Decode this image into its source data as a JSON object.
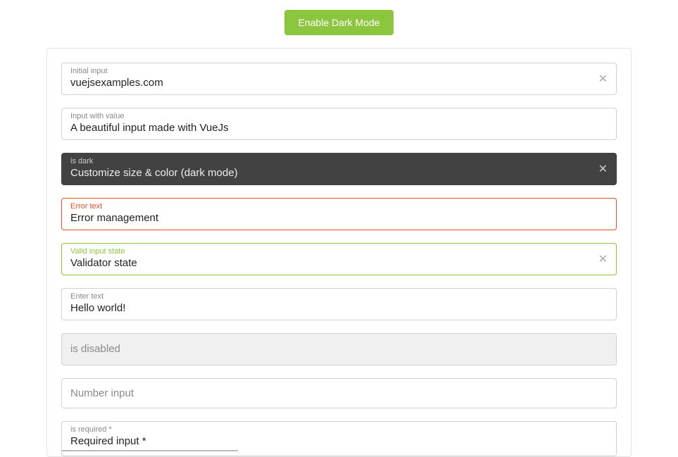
{
  "button": {
    "dark_mode": "Enable Dark Mode"
  },
  "fields": {
    "initial": {
      "label": "Initial input",
      "value": "vuejsexamples.com"
    },
    "withValue": {
      "label": "Input with value",
      "value": "A beautiful input made with VueJs"
    },
    "dark": {
      "label": "is dark",
      "value": "Customize size & color (dark mode)"
    },
    "error": {
      "label": "Error text",
      "value": "Error management"
    },
    "valid": {
      "label": "Valid input state",
      "value": "Validator state"
    },
    "hello": {
      "label": "Enter text",
      "value": "Hello world!"
    },
    "disabled": {
      "placeholder": "is disabled"
    },
    "number": {
      "placeholder": "Number input"
    },
    "required": {
      "label": "is required *",
      "value": "Required input *"
    }
  }
}
